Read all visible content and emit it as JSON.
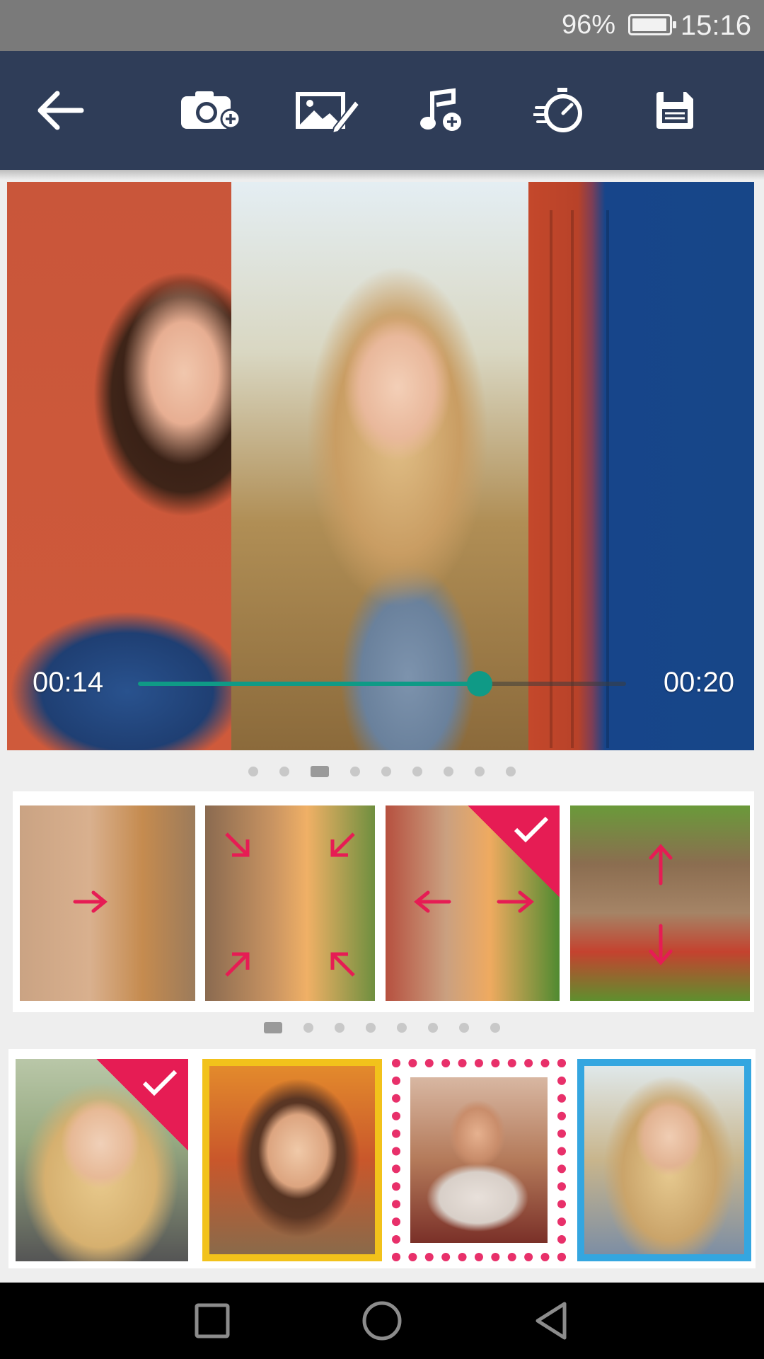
{
  "status_bar": {
    "battery": "96%",
    "battery_level": 0.96,
    "time": "15:16"
  },
  "toolbar": {
    "icons": [
      "arrow-back-icon",
      "camera-add-icon",
      "image-edit-icon",
      "music-add-icon",
      "speed-timer-icon",
      "save-icon"
    ]
  },
  "player": {
    "current_time": "00:14",
    "total_time": "00:20",
    "progress": 0.7
  },
  "transitions": {
    "page_count": 9,
    "active_page": 3,
    "selected_index": 2,
    "count": 4
  },
  "frames": {
    "page_count": 8,
    "active_page": 1,
    "selected_index": 0,
    "count": 4
  },
  "accent_colors": {
    "toolbar": "#2f3d58",
    "seek": "#0f9a86",
    "selection": "#e61c54"
  },
  "nav": {
    "icons": [
      "recent-apps-icon",
      "home-icon",
      "back-nav-icon"
    ]
  }
}
